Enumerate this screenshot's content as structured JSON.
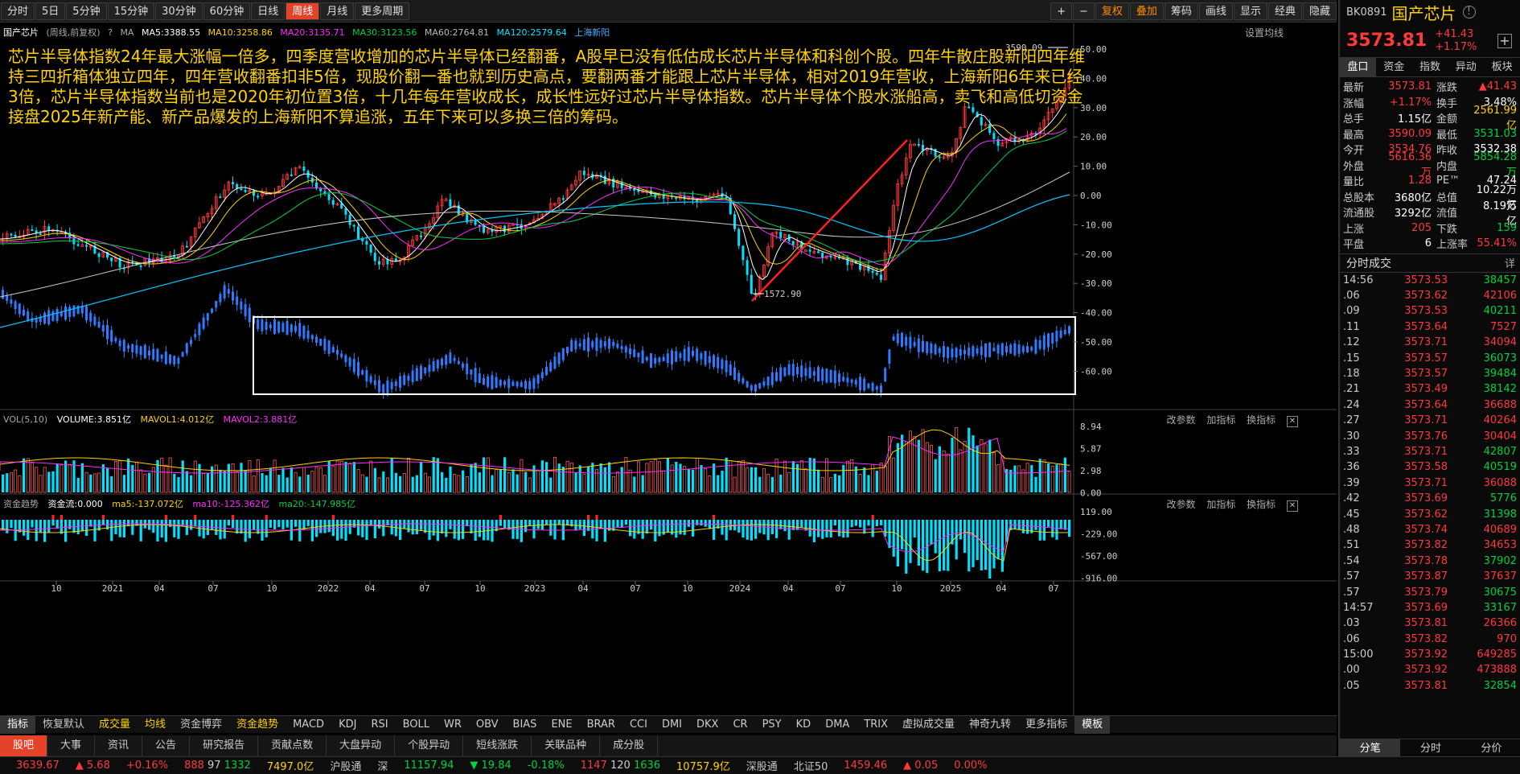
{
  "toolbar": {
    "periods": [
      "分时",
      "5日",
      "5分钟",
      "15分钟",
      "30分钟",
      "60分钟",
      "日线",
      "周线",
      "月线",
      "更多周期"
    ],
    "active_period": "周线",
    "right_buttons": [
      "+",
      "−",
      "复权",
      "叠加",
      "筹码",
      "画线",
      "显示",
      "经典",
      "隐藏"
    ]
  },
  "chart_info": {
    "name": "国产芯片",
    "mode": "(周线,前复权)",
    "ma_label": "MA",
    "ma5": "MA5:3388.55",
    "ma10": "MA10:3258.86",
    "ma20": "MA20:3135.71",
    "ma30": "MA30:3123.56",
    "ma60": "MA60:2764.81",
    "ma120": "MA120:2579.64",
    "overlay": "上海新阳",
    "settings": "设置均线"
  },
  "annotation": "芯片半导体指数24年最大涨幅一倍多，四季度营收增加的芯片半导体已经翻番，A股早已没有低估成长芯片半导体和科创个股。四年牛散庄股新阳四年维持三四折箱体独立四年，四年营收翻番扣非5倍，现股价翻一番也就到历史高点，要翻两番才能跟上芯片半导体，相对2019年营收，上海新阳6年来已经3倍，芯片半导体指数当前也是2020年初位置3倍，十几年每年营收成长，成长性远好过芯片半导体指数。芯片半导体个股水涨船高，卖飞和高低切资金接盘2025年新产能、新产品爆发的上海新阳不算追涨，五年下来可以多换三倍的筹码。",
  "chart_data": {
    "type": "line",
    "price_axis": [
      "50.00",
      "40.00",
      "30.00",
      "20.00",
      "10.00",
      "0.00",
      "-10.00",
      "-20.00",
      "-30.00",
      "-40.00",
      "-50.00",
      "-60.00"
    ],
    "high_label": "3590.09",
    "low_label": "1572.90",
    "x_ticks": [
      "10",
      "2021",
      "04",
      "07",
      "10",
      "2022",
      "04",
      "07",
      "10",
      "2023",
      "04",
      "07",
      "10",
      "2024",
      "04",
      "07",
      "10",
      "2025",
      "04",
      "07"
    ],
    "volume_axis": [
      "8.94",
      "5.87",
      "2.98",
      "0.00"
    ],
    "flow_axis": [
      "119.00",
      "-229.00",
      "-567.00",
      "-916.00"
    ]
  },
  "volume_pane": {
    "title": "VOL(5,10)",
    "volume": "VOLUME:3.851亿",
    "mavol1": "MAVOL1:4.012亿",
    "mavol2": "MAVOL2:3.881亿"
  },
  "flow_pane": {
    "title": "资金趋势",
    "flow": "资金流:0.000",
    "ma5": "ma5:-137.072亿",
    "ma10": "ma10:-125.362亿",
    "ma20": "ma20:-147.985亿"
  },
  "pane_tools": {
    "edit": "改参数",
    "add": "加指标",
    "change": "换指标"
  },
  "indicator_tabs": [
    "指标",
    "恢复默认",
    "成交量",
    "均线",
    "资金博弈",
    "资金趋势",
    "MACD",
    "KDJ",
    "RSI",
    "BOLL",
    "WR",
    "OBV",
    "BIAS",
    "ENE",
    "BRAR",
    "CCI",
    "DMI",
    "DKX",
    "CR",
    "PSY",
    "KD",
    "DMA",
    "TRIX",
    "虚拟成交量",
    "神奇九转",
    "更多指标",
    "模板"
  ],
  "bottom_tabs": [
    "股吧",
    "大事",
    "资讯",
    "公告",
    "研究报告",
    "贡献点数",
    "大盘异动",
    "个股异动",
    "短线涨跌",
    "关联品种",
    "成分股"
  ],
  "status": {
    "index_price": "3639.67",
    "index_change": "5.68",
    "index_pct": "+0.16%",
    "up": "888",
    "flat": "97",
    "down": "1332",
    "turnover": "7497.0亿",
    "hgt": "沪股通",
    "sz_label": "深",
    "sz_price": "11157.94",
    "sz_change": "19.84",
    "sz_pct": "-0.18%",
    "sz_up": "1147",
    "sz_flat": "120",
    "sz_down": "1636",
    "sz_turnover": "10757.9亿",
    "sgt": "深股通",
    "bz_label": "北证50",
    "bz_price": "1459.46",
    "bz_change": "0.05",
    "bz_pct": "0.00%"
  },
  "side": {
    "code": "BK0891",
    "name": "国产芯片",
    "price": "3573.81",
    "change": "+41.43",
    "pct": "+1.17%",
    "tabs": [
      "盘口",
      "资金",
      "指数",
      "异动",
      "板块"
    ],
    "quotes": [
      [
        "最新",
        "3573.81",
        "涨跌",
        "▲41.43"
      ],
      [
        "涨幅",
        "+1.17%",
        "换手",
        "3.48%"
      ],
      [
        "总手",
        "1.15亿",
        "金额",
        "2561.99亿"
      ],
      [
        "最高",
        "3590.09",
        "最低",
        "3531.03"
      ],
      [
        "今开",
        "3534.76",
        "昨收",
        "3532.38"
      ],
      [
        "外盘",
        "5616.36万",
        "内盘",
        "5854.28万"
      ],
      [
        "量比",
        "1.28",
        "PE™",
        "47.24"
      ],
      [
        "总股本",
        "3680亿",
        "总值",
        "10.22万亿"
      ],
      [
        "流通股",
        "3292亿",
        "流值",
        "8.19万亿"
      ],
      [
        "上涨",
        "205",
        "下跌",
        "159"
      ],
      [
        "平盘",
        "6",
        "上涨率",
        "55.41%"
      ]
    ],
    "tick_title": "分时成交",
    "tick_more": "详",
    "ticks": [
      [
        "14:56",
        "3573.53",
        "38457"
      ],
      [
        ".06",
        "3573.62",
        "42106"
      ],
      [
        ".09",
        "3573.53",
        "40211"
      ],
      [
        ".11",
        "3573.64",
        "7527"
      ],
      [
        ".12",
        "3573.71",
        "34094"
      ],
      [
        ".15",
        "3573.57",
        "36073"
      ],
      [
        ".18",
        "3573.57",
        "39484"
      ],
      [
        ".21",
        "3573.49",
        "38142"
      ],
      [
        ".24",
        "3573.64",
        "36688"
      ],
      [
        ".27",
        "3573.71",
        "40264"
      ],
      [
        ".30",
        "3573.76",
        "30404"
      ],
      [
        ".33",
        "3573.71",
        "42807"
      ],
      [
        ".36",
        "3573.58",
        "40519"
      ],
      [
        ".39",
        "3573.71",
        "36088"
      ],
      [
        ".42",
        "3573.69",
        "5776"
      ],
      [
        ".45",
        "3573.62",
        "31398"
      ],
      [
        ".48",
        "3573.74",
        "40689"
      ],
      [
        ".51",
        "3573.82",
        "34653"
      ],
      [
        ".54",
        "3573.78",
        "37902"
      ],
      [
        ".57",
        "3573.87",
        "37637"
      ],
      [
        ".57",
        "3573.79",
        "30675"
      ],
      [
        "14:57",
        "3573.69",
        "33167"
      ],
      [
        ".03",
        "3573.81",
        "26366"
      ],
      [
        ".06",
        "3573.82",
        "970"
      ],
      [
        "15:00",
        "3573.92",
        "649285"
      ],
      [
        ".00",
        "3573.92",
        "473888"
      ],
      [
        ".05",
        "3573.81",
        "32854"
      ]
    ],
    "tick_colors": [
      "green",
      "red",
      "green",
      "red",
      "red",
      "green",
      "green",
      "green",
      "red",
      "red",
      "red",
      "green",
      "green",
      "red",
      "green",
      "green",
      "red",
      "red",
      "green",
      "red",
      "green",
      "green",
      "red",
      "red",
      "red",
      "red",
      "green"
    ],
    "bottom_tabs": [
      "分笔",
      "分时",
      "分价"
    ]
  }
}
